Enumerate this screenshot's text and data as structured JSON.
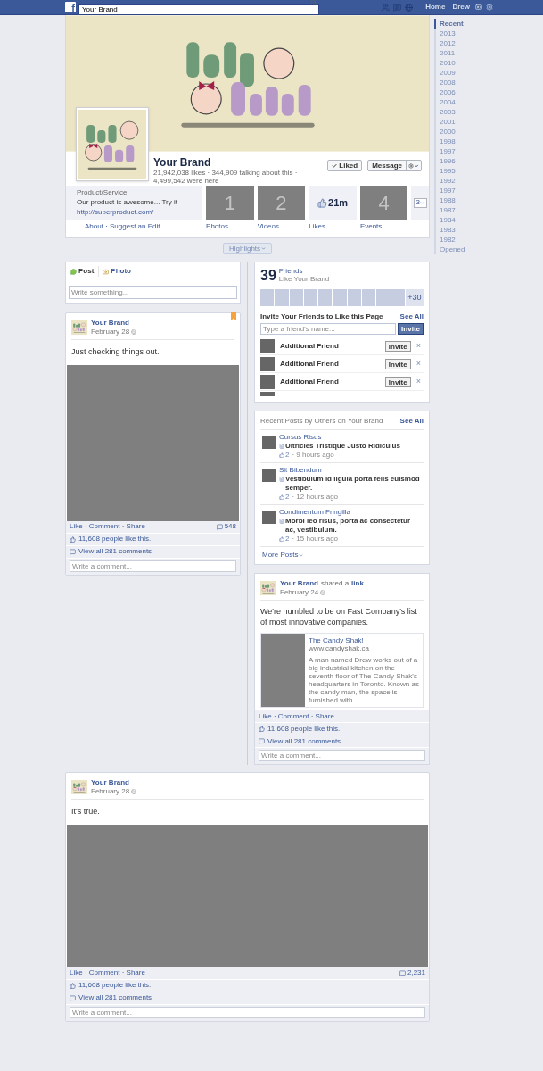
{
  "top_bar": {
    "logo": "f",
    "search_value": "Your Brand",
    "nav": [
      "Home",
      "Drew"
    ]
  },
  "page": {
    "name": "Your Brand",
    "stats": "21,942,038 likes · 344,909 talking about this · 4,499,542 were here",
    "liked_button": {
      "label": "Liked",
      "liked": true
    },
    "message_button": "Message"
  },
  "about": {
    "category": "Product/Service",
    "description": "Our product is awesome... Try it",
    "url": "http://superproduct.com/",
    "links": "About · Suggest an Edit"
  },
  "apps": [
    {
      "kind": "placeholder",
      "number": "1",
      "label": "Photos"
    },
    {
      "kind": "placeholder",
      "number": "2",
      "label": "Videos"
    },
    {
      "kind": "likes",
      "value": "21m",
      "label": "Likes"
    },
    {
      "kind": "placeholder",
      "number": "4",
      "label": "Events"
    }
  ],
  "apps_more": "3",
  "highlights": "Highlights",
  "timeline_nav": [
    {
      "label": "Recent",
      "selected": true
    },
    {
      "label": "2013",
      "selected": false
    },
    {
      "label": "2012",
      "selected": false
    },
    {
      "label": "2011",
      "selected": false
    },
    {
      "label": "2010",
      "selected": false
    },
    {
      "label": "2009",
      "selected": false
    },
    {
      "label": "2008",
      "selected": false
    },
    {
      "label": "2006",
      "selected": false
    },
    {
      "label": "2004",
      "selected": false
    },
    {
      "label": "2003",
      "selected": false
    },
    {
      "label": "2001",
      "selected": false
    },
    {
      "label": "2000",
      "selected": false
    },
    {
      "label": "1998",
      "selected": false
    },
    {
      "label": "1997",
      "selected": false
    },
    {
      "label": "1996",
      "selected": false
    },
    {
      "label": "1995",
      "selected": false
    },
    {
      "label": "1992",
      "selected": false
    },
    {
      "label": "1997",
      "selected": false
    },
    {
      "label": "1988",
      "selected": false
    },
    {
      "label": "1987",
      "selected": false
    },
    {
      "label": "1984",
      "selected": false
    },
    {
      "label": "1983",
      "selected": false
    },
    {
      "label": "1982",
      "selected": false
    },
    {
      "label": "Opened",
      "selected": false
    }
  ],
  "composer": {
    "tabs": [
      {
        "label": "Post",
        "kind": "post",
        "selected": true
      },
      {
        "label": "Photo",
        "selected": false
      }
    ],
    "placeholder": "Write something..."
  },
  "left_post": {
    "author": "Your Brand",
    "date": "February 28",
    "starred": true,
    "text": "Just checking things out.",
    "actions": "Like · Comment · Share",
    "comment_count": "548",
    "likes": "11,608 people like this.",
    "view_comments": "View all 281 comments",
    "comment_placeholder": "Write a comment..."
  },
  "friends_box": {
    "count": "39",
    "title": "Friends",
    "subtitle": "Like Your Brand",
    "more": "+30",
    "invite_heading": "Invite Your Friends to Like this Page",
    "see_all": "See All",
    "placeholder": "Type a friend's name...",
    "invite_button": "Invite",
    "friends": [
      {
        "name": "Additional Friend",
        "button": "Invite",
        "dismiss": "×"
      },
      {
        "name": "Additional Friend",
        "button": "Invite",
        "dismiss": "×"
      },
      {
        "name": "Additional Friend",
        "button": "Invite",
        "dismiss": "×"
      }
    ]
  },
  "recent_posts": {
    "title": "Recent Posts by Others on Your Brand",
    "see_all": "See All",
    "items": [
      {
        "author": "Cursus Risus",
        "text": "Ultricies Tristique Justo Ridiculus",
        "likes": "2",
        "time": "· 9 hours ago"
      },
      {
        "author": "Sit Bibendum",
        "text": "Vestibulum id ligula porta felis euismod semper.",
        "likes": "2",
        "time": "· 12 hours ago"
      },
      {
        "author": "Condimentum Fringilla",
        "text": "Morbi leo risus, porta ac consectetur ac, vestibulum.",
        "likes": "2",
        "time": "· 15 hours ago"
      }
    ],
    "more": "More Posts"
  },
  "shared_post": {
    "author": "Your Brand",
    "verb": "shared a",
    "link": "link.",
    "date": "February 24",
    "text": "We're humbled to be on Fast Company's list of most innovative companies.",
    "preview": {
      "title": "The Candy Shak!",
      "url": "www.candyshak.ca",
      "description": "A man named Drew works out of a big industrial kitchen on the seventh floor of The Candy Shak's headquarters in Toronto. Known as the candy man, the space is furnished with..."
    },
    "actions": "Like · Comment · Share",
    "likes": "11,608 people like this.",
    "view_comments": "View all 281 comments",
    "comment_placeholder": "Write a comment..."
  },
  "wide_post": {
    "author": "Your Brand",
    "date": "February 28",
    "starred": false,
    "text": "It's true.",
    "actions": "Like · Comment · Share",
    "comment_count": "2,231",
    "likes": "11,608 people like this.",
    "view_comments": "View all 281 comments",
    "comment_placeholder": "Write a comment..."
  }
}
